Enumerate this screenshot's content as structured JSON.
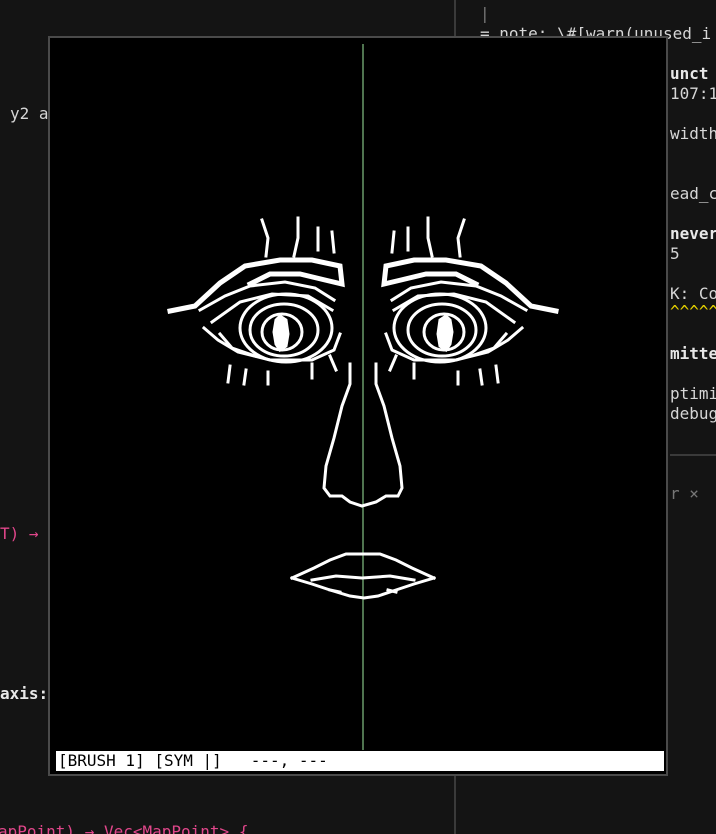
{
  "background": {
    "left_fragments": [
      "y2 a",
      "T) →",
      "axis:",
      "apPoint) → Vec<MapPoint> {"
    ],
    "right_fragments": [
      "= note: \\#[warn(unused_i",
      "unct",
      "107:1",
      "width",
      "ead_c",
      "never",
      "5",
      "K: Co",
      "^^^^^",
      "mitte",
      "ptimi",
      "debug",
      "r ×"
    ]
  },
  "canvas": {
    "status": {
      "brush": "[BRUSH 1]",
      "symmetry": "[SYM |]",
      "cursor": "---, ---"
    },
    "colors": {
      "canvas_bg": "#000000",
      "stroke": "#ffffff",
      "symmetry_guide": "#9ee89e",
      "status_bg": "#ffffff"
    }
  }
}
